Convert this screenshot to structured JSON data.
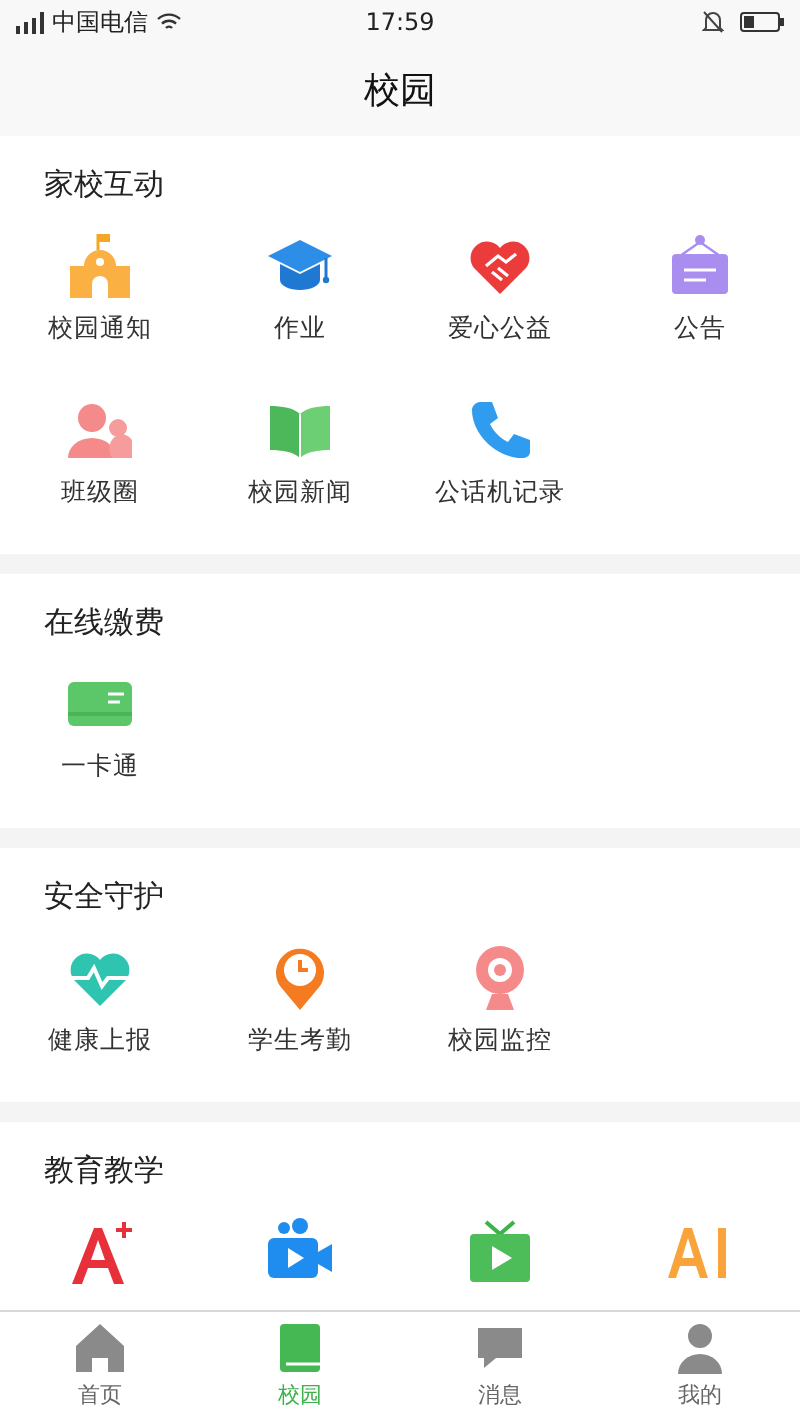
{
  "status_bar": {
    "carrier": "中国电信",
    "time": "17:59"
  },
  "header": {
    "title": "校园"
  },
  "sections": [
    {
      "title": "家校互动",
      "items": [
        {
          "label": "校园通知"
        },
        {
          "label": "作业"
        },
        {
          "label": "爱心公益"
        },
        {
          "label": "公告"
        },
        {
          "label": "班级圈"
        },
        {
          "label": "校园新闻"
        },
        {
          "label": "公话机记录"
        }
      ]
    },
    {
      "title": "在线缴费",
      "items": [
        {
          "label": "一卡通"
        }
      ]
    },
    {
      "title": "安全守护",
      "items": [
        {
          "label": "健康上报"
        },
        {
          "label": "学生考勤"
        },
        {
          "label": "校园监控"
        }
      ]
    },
    {
      "title": "教育教学"
    }
  ],
  "tab_bar": [
    {
      "label": "首页",
      "selected": false
    },
    {
      "label": "校园",
      "selected": true
    },
    {
      "label": "消息",
      "selected": false
    },
    {
      "label": "我的",
      "selected": false
    }
  ]
}
